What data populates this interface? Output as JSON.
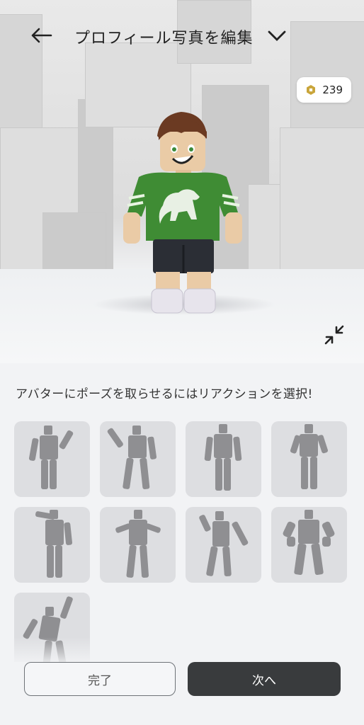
{
  "header": {
    "title": "プロフィール写真を編集",
    "back_icon": "arrow-left-icon",
    "dropdown_icon": "chevron-down-icon"
  },
  "currency": {
    "amount": "239",
    "icon": "robux-icon"
  },
  "scene": {
    "collapse_icon": "collapse-icon"
  },
  "reactions": {
    "prompt": "アバターにポーズを取らせるにはリアクションを選択!",
    "items": [
      {
        "name": "wave"
      },
      {
        "name": "salute-left"
      },
      {
        "name": "idle-stand"
      },
      {
        "name": "arms-akimbo"
      },
      {
        "name": "salute"
      },
      {
        "name": "shrug"
      },
      {
        "name": "point"
      },
      {
        "name": "flex"
      },
      {
        "name": "cheer"
      }
    ]
  },
  "footer": {
    "done_label": "完了",
    "next_label": "次へ"
  },
  "colors": {
    "accent_dark": "#393b3d",
    "tile_bg": "#dddee1",
    "silhouette": "#8f8f92"
  }
}
